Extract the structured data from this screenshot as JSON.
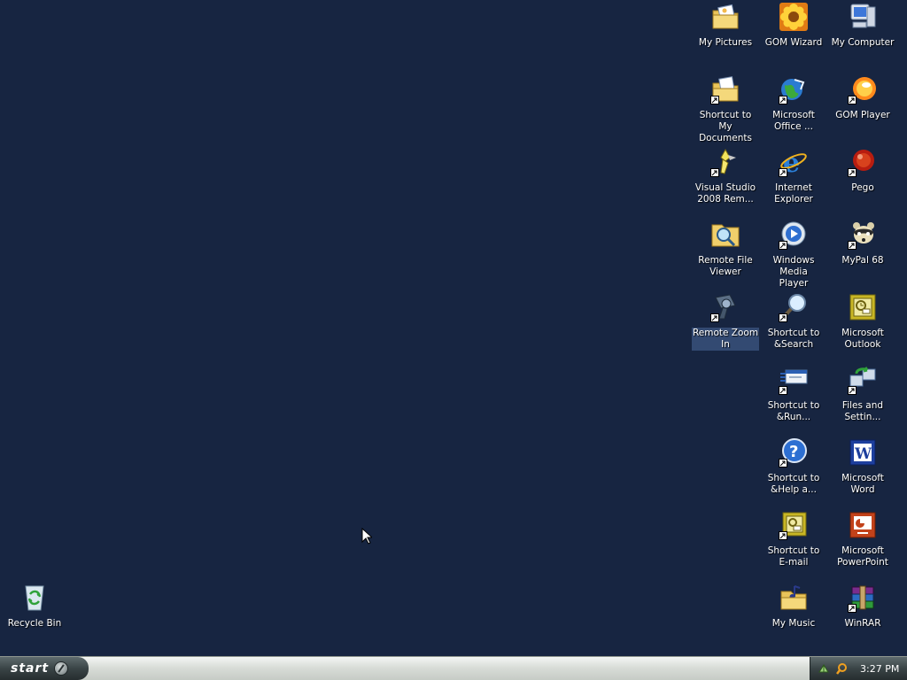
{
  "desktop": {
    "background_color": "#172541",
    "icons": [
      {
        "id": "my-pictures",
        "label": "My Pictures",
        "icon": "folder-pictures-icon",
        "shortcut": false
      },
      {
        "id": "gom-wizard",
        "label": "GOM Wizard",
        "icon": "sunflower-icon",
        "shortcut": false
      },
      {
        "id": "my-computer",
        "label": "My Computer",
        "icon": "computer-icon",
        "shortcut": false
      },
      {
        "id": "shortcut-my-documents",
        "label": "Shortcut to My\nDocuments",
        "icon": "folder-documents-icon",
        "shortcut": true
      },
      {
        "id": "microsoft-office",
        "label": "Microsoft\nOffice ...",
        "icon": "office-globe-icon",
        "shortcut": true
      },
      {
        "id": "gom-player",
        "label": "GOM Player",
        "icon": "gom-player-icon",
        "shortcut": true
      },
      {
        "id": "visual-studio",
        "label": "Visual Studio\n2008 Rem...",
        "icon": "visual-studio-icon",
        "shortcut": true
      },
      {
        "id": "internet-explorer",
        "label": "Internet\nExplorer",
        "icon": "internet-explorer-icon",
        "shortcut": true
      },
      {
        "id": "pego",
        "label": "Pego",
        "icon": "pego-ball-icon",
        "shortcut": true
      },
      {
        "id": "remote-file-viewer",
        "label": "Remote File\nViewer",
        "icon": "folder-magnifier-icon",
        "shortcut": false
      },
      {
        "id": "windows-media-player",
        "label": "Windows Media\nPlayer",
        "icon": "media-player-icon",
        "shortcut": true
      },
      {
        "id": "mypal",
        "label": "MyPal 68",
        "icon": "raccoon-icon",
        "shortcut": true
      },
      {
        "id": "remote-zoom-in",
        "label": "Remote Zoom\nIn",
        "icon": "zoom-camera-icon",
        "shortcut": true,
        "selected": true
      },
      {
        "id": "shortcut-search",
        "label": "Shortcut to\n&Search",
        "icon": "search-magnifier-icon",
        "shortcut": true
      },
      {
        "id": "microsoft-outlook",
        "label": "Microsoft\nOutlook",
        "icon": "outlook-icon",
        "shortcut": false
      },
      {
        "id": "shortcut-run",
        "label": "Shortcut to\n&Run...",
        "icon": "run-dialog-icon",
        "shortcut": true
      },
      {
        "id": "files-and-settings",
        "label": "Files and\nSettin...",
        "icon": "files-transfer-icon",
        "shortcut": true
      },
      {
        "id": "shortcut-help",
        "label": "Shortcut to\n&Help a...",
        "icon": "help-icon",
        "shortcut": true
      },
      {
        "id": "microsoft-word",
        "label": "Microsoft Word",
        "icon": "word-icon",
        "shortcut": false
      },
      {
        "id": "shortcut-email",
        "label": "Shortcut to\nE-mail",
        "icon": "email-icon",
        "shortcut": true
      },
      {
        "id": "microsoft-powerpoint",
        "label": "Microsoft\nPowerPoint",
        "icon": "powerpoint-icon",
        "shortcut": false
      },
      {
        "id": "my-music",
        "label": "My Music",
        "icon": "folder-music-icon",
        "shortcut": false
      },
      {
        "id": "winrar",
        "label": "WinRAR",
        "icon": "winrar-icon",
        "shortcut": true
      },
      {
        "id": "recycle-bin",
        "label": "Recycle Bin",
        "icon": "recycle-bin-icon",
        "shortcut": false
      }
    ]
  },
  "taskbar": {
    "start_label": "start",
    "clock": "3:27 PM",
    "tray_icons": [
      "network-icon",
      "search-icon"
    ]
  }
}
